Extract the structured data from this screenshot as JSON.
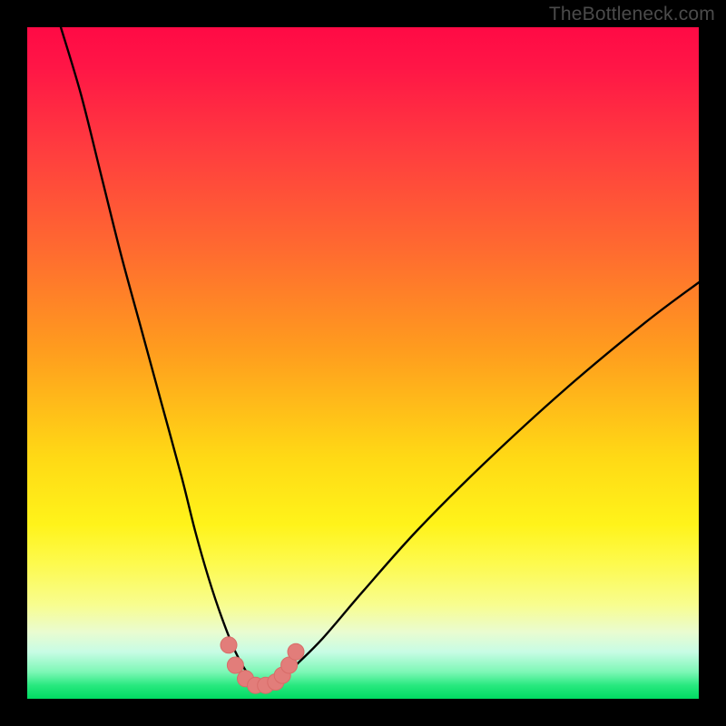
{
  "watermark": "TheBottleneck.com",
  "colors": {
    "frame": "#000000",
    "curve_stroke": "#000000",
    "marker_fill": "#e27d7a",
    "marker_stroke": "#d86c68",
    "gradient_top": "#ff0a45",
    "gradient_bottom": "#00db62"
  },
  "chart_data": {
    "type": "line",
    "title": "",
    "xlabel": "",
    "ylabel": "",
    "xlim": [
      0,
      100
    ],
    "ylim": [
      0,
      100
    ],
    "series": [
      {
        "name": "bottleneck-curve",
        "x": [
          5,
          8,
          11,
          14,
          17,
          20,
          23,
          25,
          27,
          29,
          31,
          33,
          34.5,
          36,
          38,
          40,
          44,
          50,
          58,
          68,
          80,
          92,
          100
        ],
        "y": [
          100,
          90,
          78,
          66,
          55,
          44,
          33,
          25,
          18,
          12,
          7,
          3.5,
          2,
          2,
          3,
          5,
          9,
          16,
          25,
          35,
          46,
          56,
          62
        ]
      }
    ],
    "markers": {
      "name": "highlight-points",
      "x": [
        30,
        31,
        32.5,
        34,
        35.5,
        37,
        38,
        39,
        40
      ],
      "y": [
        8,
        5,
        3,
        2,
        2,
        2.5,
        3.5,
        5,
        7
      ]
    }
  }
}
